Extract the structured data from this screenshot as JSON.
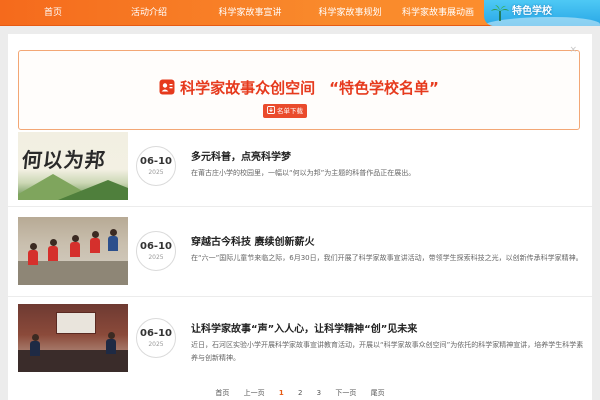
{
  "nav": {
    "items": [
      {
        "label": "首页"
      },
      {
        "label": "活动介绍"
      },
      {
        "label": "科学家故事宣讲"
      },
      {
        "label": "科学家故事规划"
      },
      {
        "label": "科学家故事展动画"
      }
    ],
    "special_label": "特色学校"
  },
  "banner": {
    "title": "科学家故事众创空间",
    "title_suffix": "“特色学校名单”",
    "download_label": "名单下载",
    "close_label": "×"
  },
  "articles": [
    {
      "day": "06-10",
      "year": "2025",
      "title": "多元科普，点亮科学梦",
      "summary": "在莆古庄小学的校园里，一幅以“何以为邦”为主题的科普作品正在展出。",
      "thumb_text": "何以为邦"
    },
    {
      "day": "06-10",
      "year": "2025",
      "title": "穿越古今科技 赓续创新薪火",
      "summary": "在“六一”国际儿童节来临之际，6月30日，我们开展了科学家故事宣讲活动，带领学生探索科技之光，以创新传承科学家精神。"
    },
    {
      "day": "06-10",
      "year": "2025",
      "title": "让科学家故事“声”入人心，让科学精神“创”见未来",
      "summary": "近日，石河区实验小学开展科学家故事宣讲教育活动，开展以“科学家故事众创空间”为依托的科学家精神宣讲，培养学生科学素养与创新精神。"
    }
  ],
  "pagination": {
    "first": "首页",
    "prev": "上一页",
    "pages": [
      "1",
      "2",
      "3"
    ],
    "next": "下一页",
    "last": "尾页",
    "current": "1"
  },
  "colors": {
    "nav": "#f56a1c",
    "accent": "#e63a1d",
    "special": "#29a7e6"
  }
}
